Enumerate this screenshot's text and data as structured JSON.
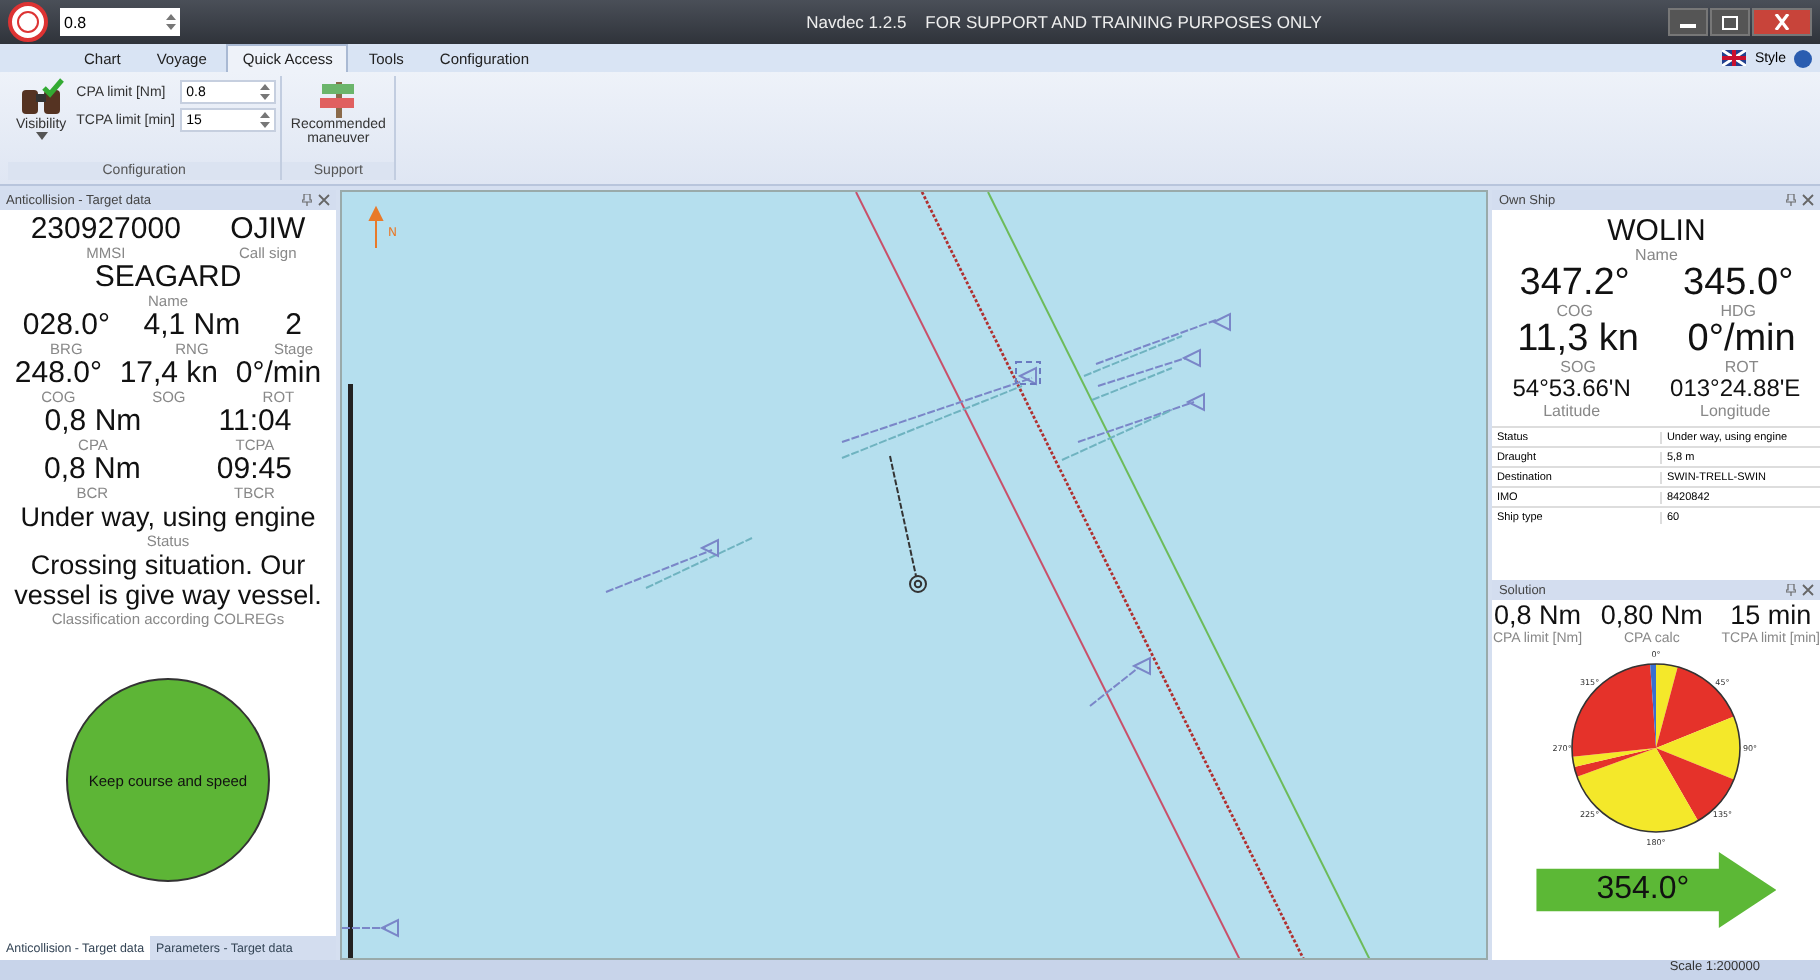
{
  "title_bar": {
    "quick_value": "0.8",
    "title": "Navdec 1.2.5    FOR SUPPORT AND TRAINING PURPOSES ONLY"
  },
  "tabs": [
    {
      "label": "Chart",
      "selected": false
    },
    {
      "label": "Voyage",
      "selected": false
    },
    {
      "label": "Quick Access",
      "selected": true
    },
    {
      "label": "Tools",
      "selected": false
    },
    {
      "label": "Configuration",
      "selected": false
    }
  ],
  "style_menu": "Style",
  "ribbon": {
    "visibility": "Visibility",
    "cpa_label": "CPA limit [Nm]",
    "cpa_value": "0.8",
    "tcpa_label": "TCPA limit [min]",
    "tcpa_value": "15",
    "group_1": "Configuration",
    "maneuver": "Recommended maneuver",
    "group_2": "Support"
  },
  "target": {
    "header": "Anticollision - Target data",
    "top": [
      {
        "value": "230927000",
        "label": "MMSI"
      },
      {
        "value": "OJIW",
        "label": "Call sign"
      }
    ],
    "name": {
      "value": "SEAGARD",
      "label": "Name"
    },
    "rows": [
      [
        {
          "value": "028.0°",
          "label": "BRG"
        },
        {
          "value": "4,1 Nm",
          "label": "RNG"
        },
        {
          "value": "2",
          "label": "Stage"
        }
      ],
      [
        {
          "value": "248.0°",
          "label": "COG"
        },
        {
          "value": "17,4 kn",
          "label": "SOG"
        },
        {
          "value": "0°/min",
          "label": "ROT"
        }
      ],
      [
        {
          "value": "0,8 Nm",
          "label": "CPA"
        },
        {
          "value": "11:04",
          "label": "TCPA"
        }
      ],
      [
        {
          "value": "0,8 Nm",
          "label": "BCR"
        },
        {
          "value": "09:45",
          "label": "TBCR"
        }
      ]
    ],
    "status": {
      "value": "Under way, using engine",
      "label": "Status"
    },
    "classification": {
      "value": "Crossing situation. Our vessel is give way vessel.",
      "label": "Classification according COLREGs"
    },
    "advice": "Keep course and speed",
    "bottom_tabs": [
      {
        "label": "Anticollision - Target data",
        "selected": true
      },
      {
        "label": "Parameters - Target data",
        "selected": false
      }
    ]
  },
  "chart": {
    "north_label": "N"
  },
  "own_ship": {
    "header": "Own Ship",
    "name": {
      "value": "WOLIN",
      "label": "Name"
    },
    "rows": [
      [
        {
          "value": "347.2°",
          "label": "COG"
        },
        {
          "value": "345.0°",
          "label": "HDG"
        }
      ],
      [
        {
          "value": "11,3 kn",
          "label": "SOG"
        },
        {
          "value": "0°/min",
          "label": "ROT"
        }
      ],
      [
        {
          "value": "54°53.66'N",
          "label": "Latitude"
        },
        {
          "value": "013°24.88'E",
          "label": "Longitude"
        }
      ]
    ],
    "table": [
      {
        "key": "Status",
        "value": "Under way, using engine"
      },
      {
        "key": "Draught",
        "value": "5,8 m"
      },
      {
        "key": "Destination",
        "value": "SWIN-TRELL-SWIN"
      },
      {
        "key": "IMO",
        "value": "8420842"
      },
      {
        "key": "Ship type",
        "value": "60"
      }
    ]
  },
  "solution": {
    "header": "Solution",
    "values": [
      {
        "value": "0,8 Nm",
        "label": "CPA limit [Nm]"
      },
      {
        "value": "0,80 Nm",
        "label": "CPA calc"
      },
      {
        "value": "15 min",
        "label": "TCPA limit [min]"
      }
    ],
    "dial_labels": [
      "0°",
      "45°",
      "90°",
      "135°",
      "180°",
      "225°",
      "270°",
      "315°"
    ],
    "course": "354.0°"
  },
  "status_bar": "Scale 1:200000"
}
